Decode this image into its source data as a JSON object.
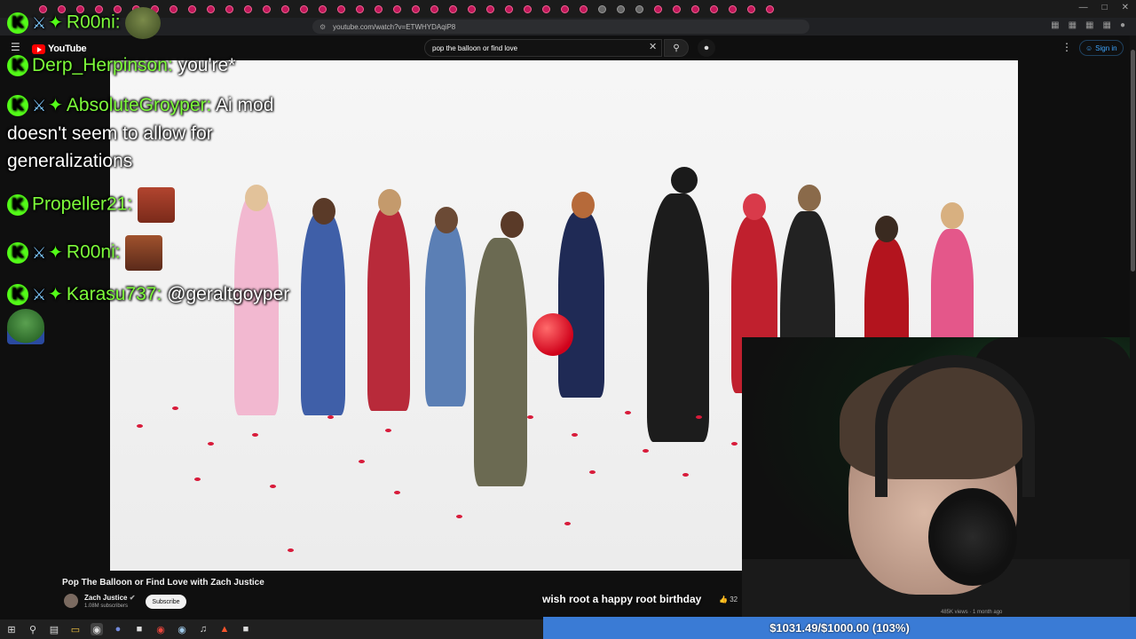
{
  "browser": {
    "url": "youtube.com/watch?v=ETWHYDAqiP8"
  },
  "youtube": {
    "logo_text": "YouTube",
    "search_query": "pop the balloon or find love",
    "signin_label": "Sign in"
  },
  "video": {
    "title": "Pop The Balloon or Find Love with Zach Justice",
    "channel_name": "Zach Justice",
    "channel_subs": "1.08M subscribers",
    "subscribe_label": "Subscribe",
    "views_meta": "485K views · 1 month ago"
  },
  "chat": {
    "messages": [
      {
        "user": "R00ni:",
        "text": ""
      },
      {
        "user": "Derp_Herpinson:",
        "text": "you're*"
      },
      {
        "user": "AbsoluteGroyper:",
        "text": "Ai mod doesn't seem to allow for generalizations"
      },
      {
        "user": "Propeller21:",
        "text": ""
      },
      {
        "user": "R00ni:",
        "text": ""
      },
      {
        "user": "Karasu737:",
        "text": "@geraltgoyper"
      }
    ]
  },
  "overlay": {
    "ticker": "wish root a happy root birthday",
    "ticker_like": "32",
    "goal": "$1031.49/$1000.00 (103%)",
    "goal_progress": 1.03
  },
  "colors": {
    "kick_green": "#53fc18",
    "username_green": "#7dfc3a",
    "goal_bar": "#3a7bd5",
    "yt_red": "#ff0000"
  }
}
